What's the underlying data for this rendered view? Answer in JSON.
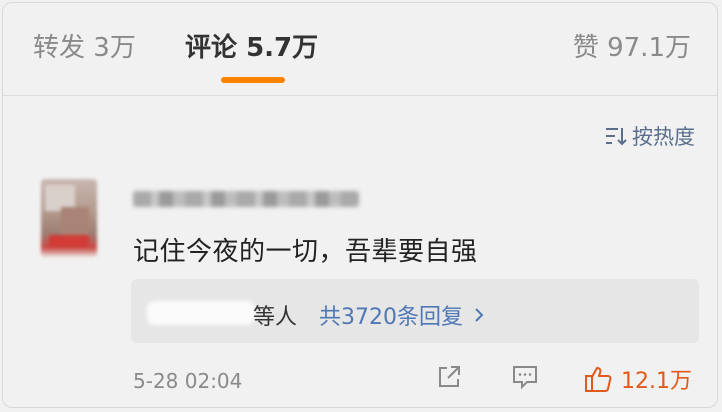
{
  "tabs": {
    "repost": {
      "label": "转发",
      "count": "3万"
    },
    "comments": {
      "label": "评论",
      "count": "5.7万"
    },
    "likes": {
      "label": "赞",
      "count": "97.1万"
    }
  },
  "sort": {
    "label": "按热度",
    "icon": "sort-icon"
  },
  "comment": {
    "text": "记住今夜的一切，吾辈要自强",
    "timestamp": "5-28 02:04",
    "replies": {
      "names_suffix": "等人",
      "link": "共3720条回复"
    },
    "like_count": "12.1万"
  },
  "colors": {
    "accent": "#ff8200",
    "link": "#4f78b5",
    "like": "#e05a1c"
  }
}
